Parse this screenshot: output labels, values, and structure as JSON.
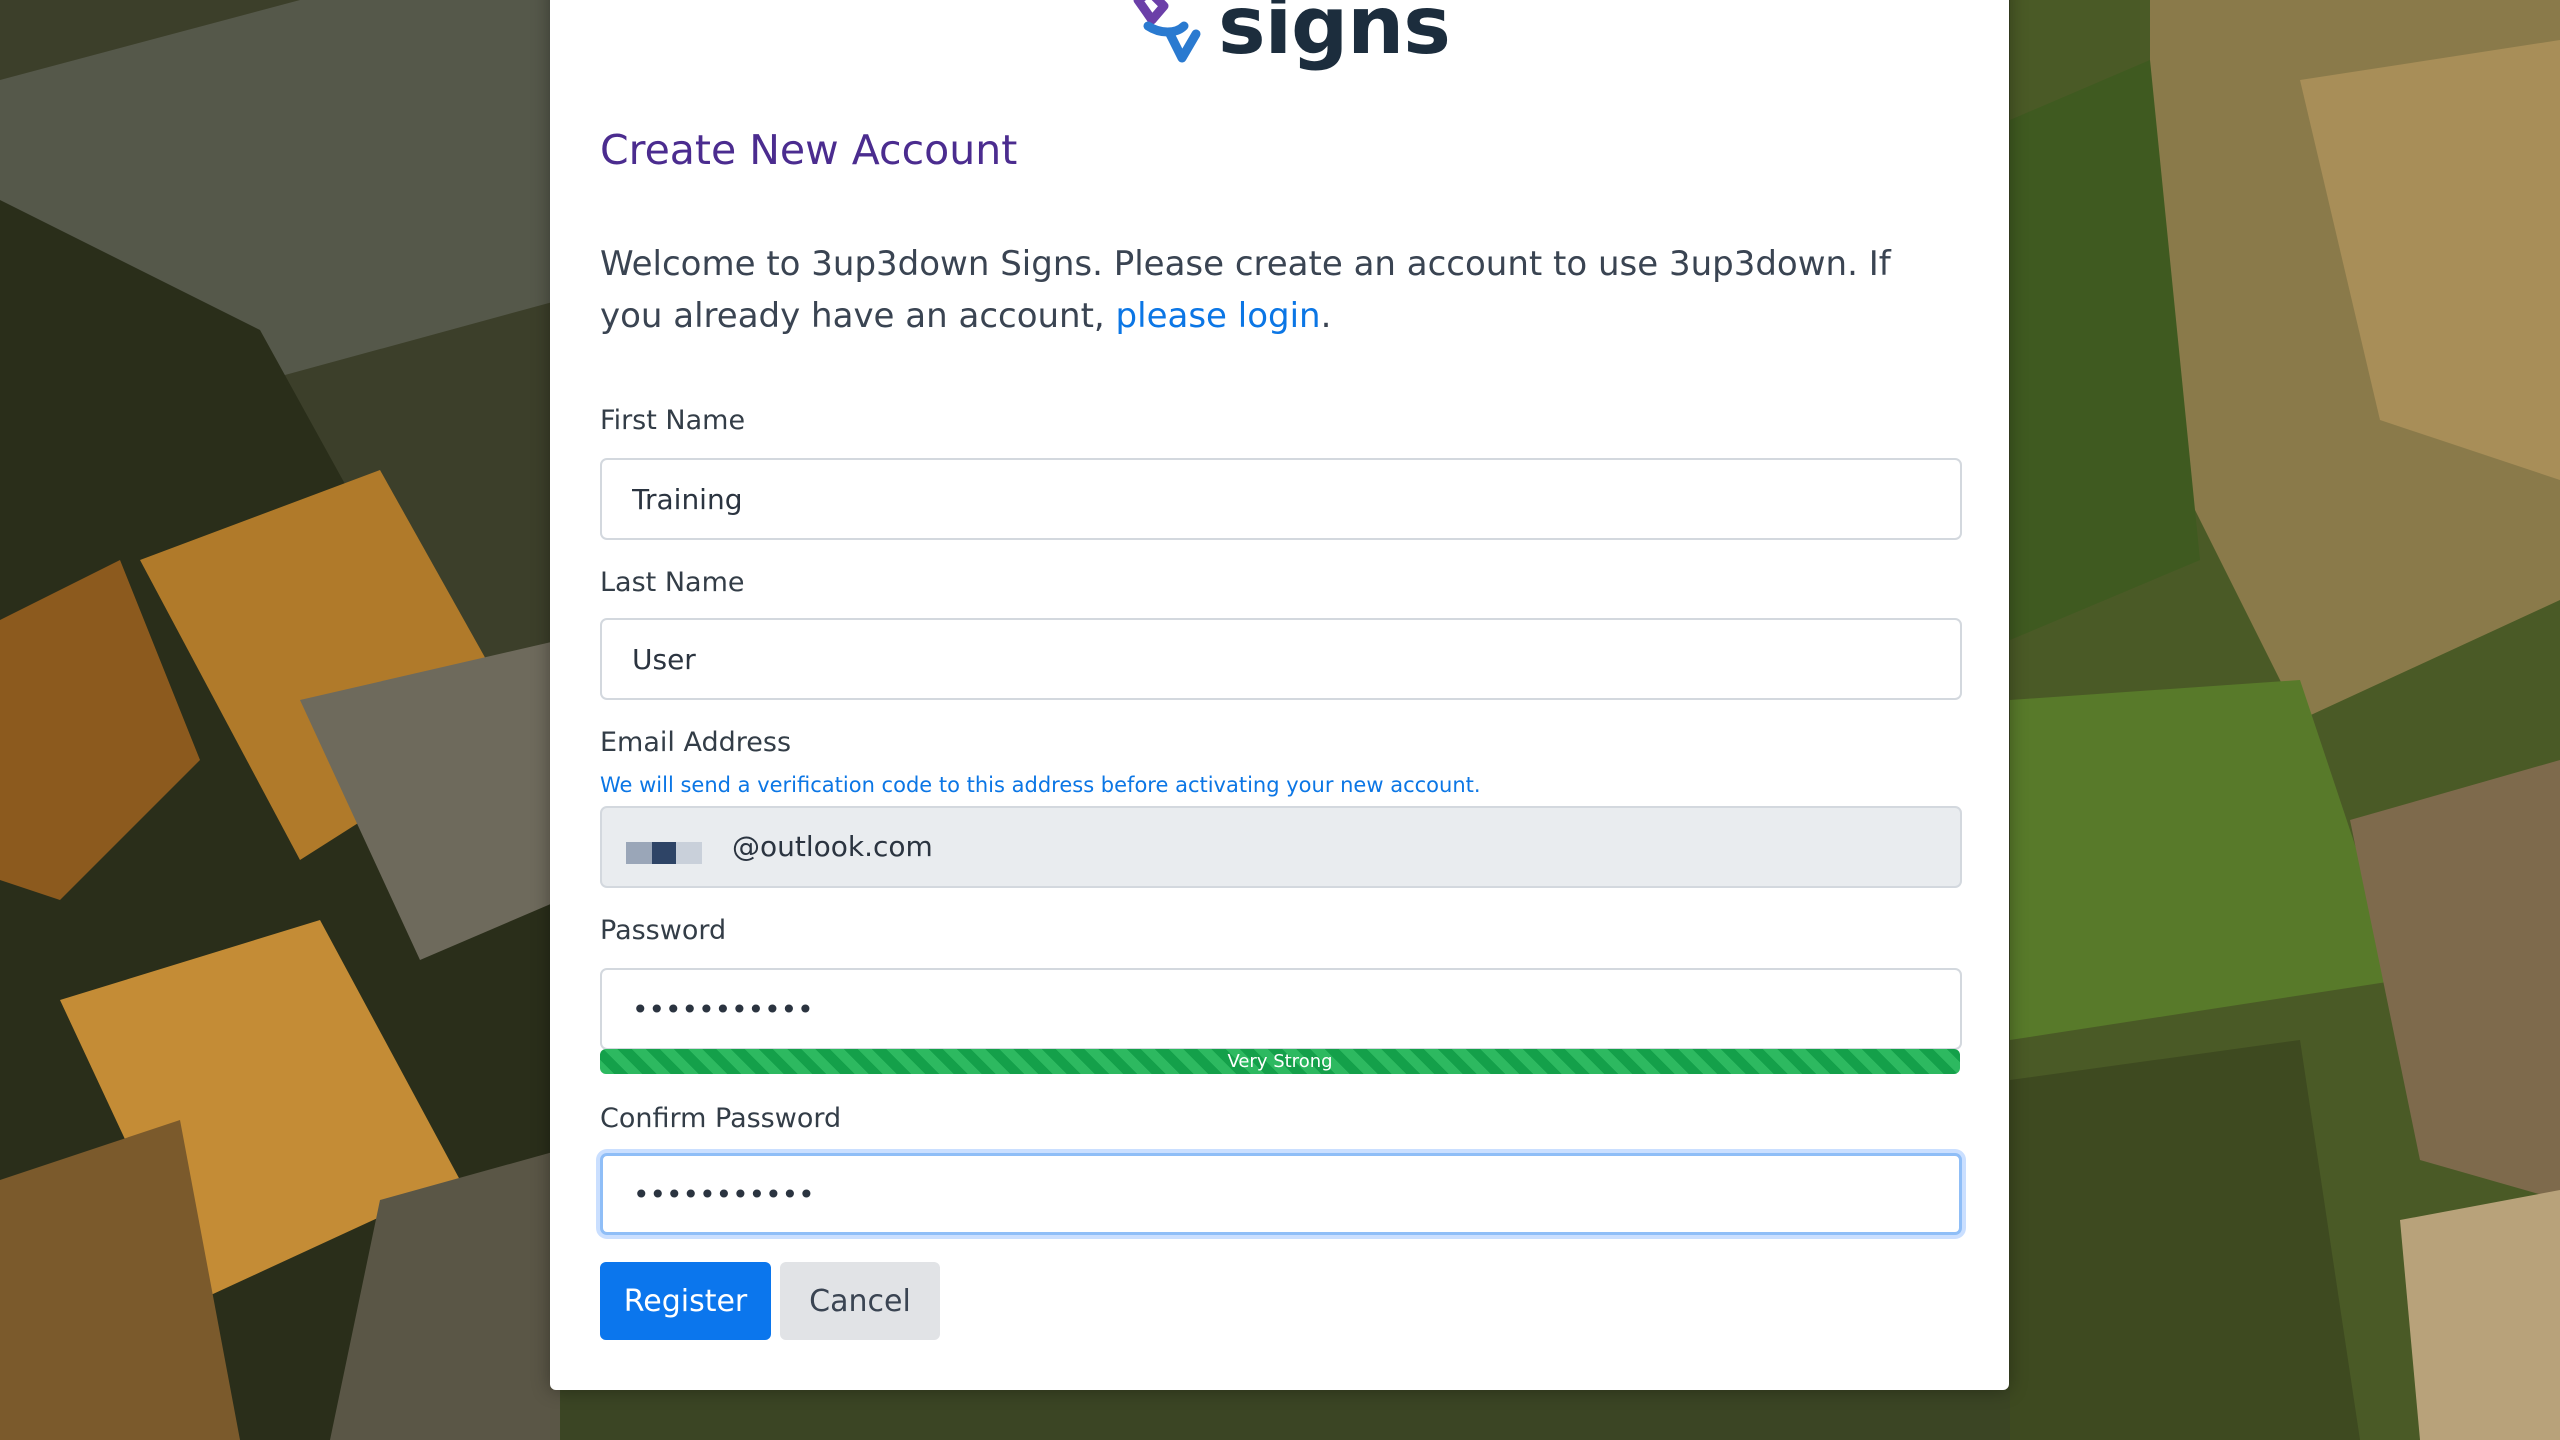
{
  "brand": {
    "logo_text": "signs"
  },
  "page": {
    "title": "Create New Account",
    "intro_text": "Welcome to 3up3down Signs. Please create an account to use 3up3down. If you already have an account, ",
    "login_link": "please login",
    "intro_end": "."
  },
  "form": {
    "first_name": {
      "label": "First Name",
      "value": "Training"
    },
    "last_name": {
      "label": "Last Name",
      "value": "User"
    },
    "email": {
      "label": "Email Address",
      "help": "We will send a verification code to this address before activating your new account.",
      "domain": "@outlook.com"
    },
    "password": {
      "label": "Password",
      "value": "•••••••••••",
      "strength_label": "Very Strong",
      "strength_level": 1.0
    },
    "confirm_password": {
      "label": "Confirm Password",
      "value": "•••••••••••"
    }
  },
  "actions": {
    "register": "Register",
    "cancel": "Cancel"
  },
  "colors": {
    "title": "#4b2c8f",
    "link": "#0b76e5",
    "primary_button": "#0b76ed",
    "strength_bar": "#2db960",
    "logo_purple": "#6b3fa8",
    "logo_blue": "#2a7ad0"
  }
}
